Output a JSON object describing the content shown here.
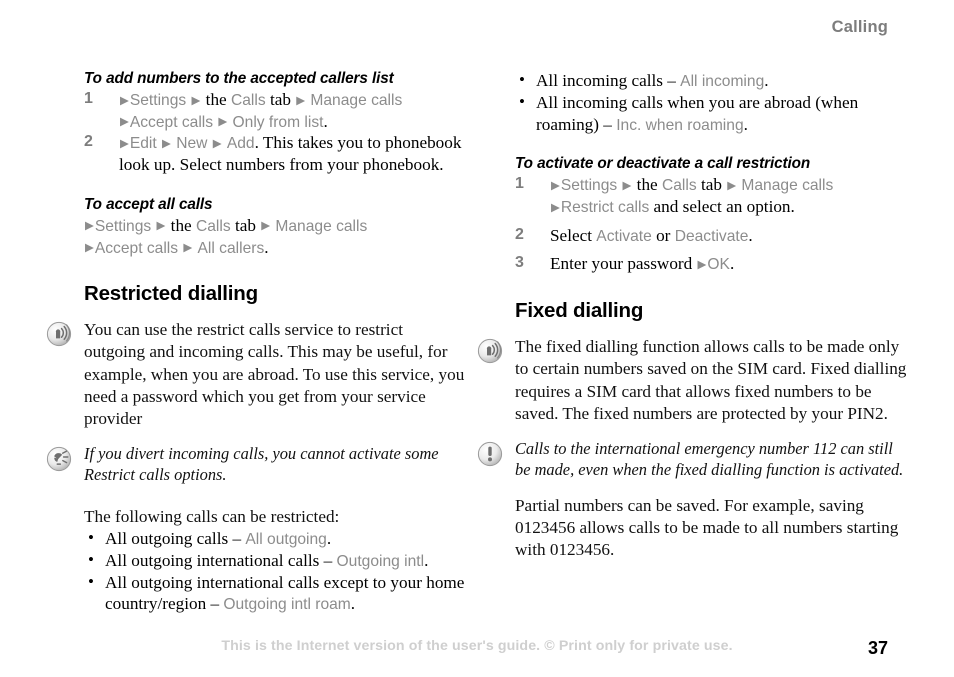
{
  "header": {
    "chapter": "Calling"
  },
  "footer": {
    "notice": "This is the Internet version of the user's guide. © Print only for private use.",
    "page_number": "37"
  },
  "left_column": {
    "sub1_title": "To add numbers to the accepted callers list",
    "sub1_steps": [
      {
        "num": "1",
        "line1": {
          "a1": "▶",
          "t1": "Settings",
          "a2": "▶",
          "plain1": "the",
          "t2": "Calls",
          "plain2": "tab",
          "a3": "▶",
          "t3": "Manage calls"
        },
        "line2": {
          "a1": "▶",
          "t1": "Accept calls",
          "a2": "▶",
          "t2": "Only from list",
          "tail": "."
        }
      },
      {
        "num": "2",
        "line1": {
          "a1": "▶",
          "t1": "Edit",
          "a2": "▶",
          "t2": "New",
          "a3": "▶",
          "t3": "Add",
          "tail": ". This takes you to phonebook look up. Select numbers from your phonebook."
        }
      }
    ],
    "sub2_title": "To accept all calls",
    "sub2_lines": [
      {
        "a1": "▶",
        "t1": "Settings",
        "a2": "▶",
        "plain1": "the",
        "t2": "Calls",
        "plain2": "tab",
        "a3": "▶",
        "t3": "Manage calls"
      },
      {
        "a1": "▶",
        "t1": "Accept calls",
        "a2": "▶",
        "t2": "All callers",
        "tail": "."
      }
    ],
    "section_title": "Restricted dialling",
    "info_icon": "broadcast-signal-icon",
    "info_text": "You can use the restrict calls service to restrict outgoing and incoming calls. This may be useful, for example, when you are abroad. To use this service, you need a password which you get from your service provider",
    "tip_icon": "tip-bulb-icon",
    "tip_text": "If you divert incoming calls, you cannot activate some Restrict calls options.",
    "list_intro": "The following calls can be restricted:",
    "bullets": [
      {
        "plain": "All outgoing calls – ",
        "ui": "All outgoing",
        "tail": "."
      },
      {
        "plain": "All outgoing international calls – ",
        "ui": "Outgoing intl",
        "tail": "."
      },
      {
        "plain": "All outgoing international calls except to your home country/region – ",
        "ui": "Outgoing intl roam",
        "tail": "."
      }
    ]
  },
  "right_column": {
    "bullets": [
      {
        "plain": "All incoming calls – ",
        "ui": "All incoming",
        "tail": "."
      },
      {
        "plain": "All incoming calls when you are abroad (when roaming) – ",
        "ui": "Inc. when roaming",
        "tail": "."
      }
    ],
    "sub1_title": "To activate or deactivate a call restriction",
    "sub1_steps": [
      {
        "num": "1",
        "line1": {
          "a1": "▶",
          "t1": "Settings",
          "a2": "▶",
          "plain1": "the",
          "t2": "Calls",
          "plain2": "tab",
          "a3": "▶",
          "t3": "Manage calls"
        },
        "line2": {
          "a1": "▶",
          "t1": "Restrict calls",
          "tail": " and select an option."
        }
      },
      {
        "num": "2",
        "line1": {
          "plain0": "Select ",
          "t1": "Activate",
          "plain1": " or ",
          "t2": "Deactivate",
          "tail": "."
        }
      },
      {
        "num": "3",
        "line1": {
          "plain0": "Enter your password ",
          "a1": "▶",
          "t1": "OK",
          "tail": "."
        }
      }
    ],
    "section_title": "Fixed dialling",
    "info_icon": "broadcast-signal-icon",
    "info_text": "The fixed dialling function allows calls to be made only to certain numbers saved on the SIM card. Fixed dialling requires a SIM card that allows fixed numbers to be saved. The fixed numbers are protected by your PIN2.",
    "warn_icon": "exclamation-circle-icon",
    "warn_text": "Calls to the international emergency number 112 can still be made, even when the fixed dialling function is activated.",
    "extra_text": "Partial numbers can be saved. For example, saving 0123456 allows calls to be made to all numbers starting with 0123456."
  }
}
